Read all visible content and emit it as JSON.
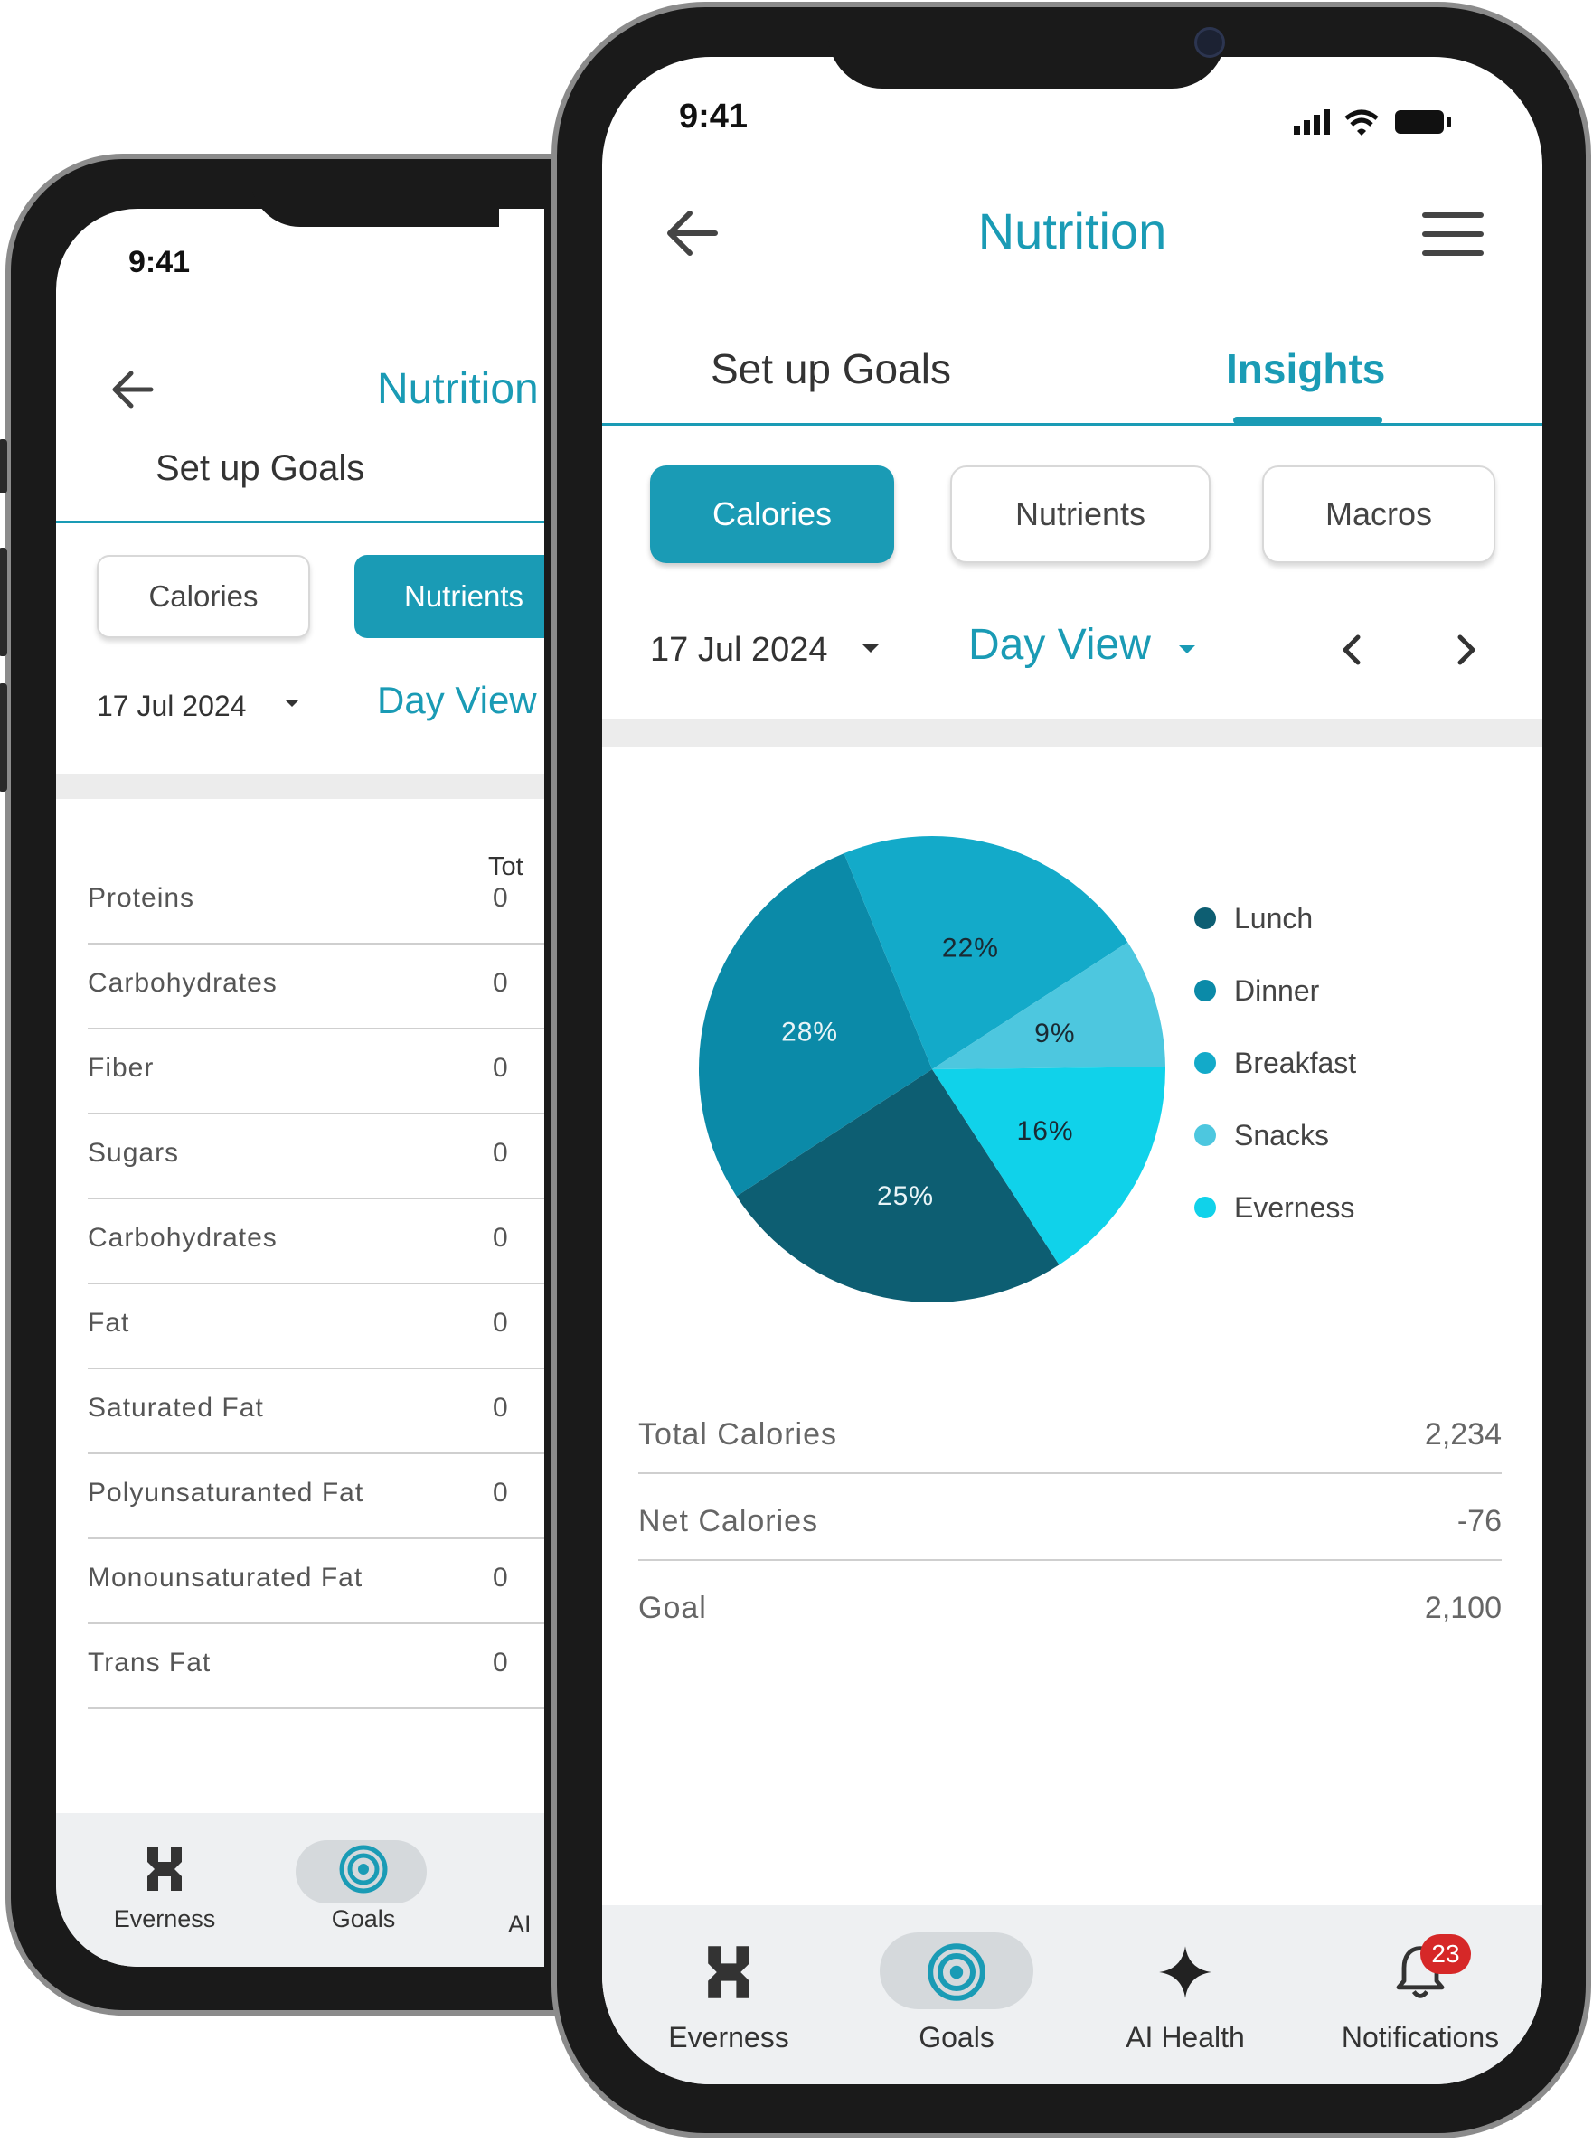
{
  "back_phone": {
    "time": "9:41",
    "title": "Nutrition",
    "tab_setup": "Set up Goals",
    "chip_calories": "Calories",
    "chip_nutrients": "Nutrients",
    "date": "17 Jul 2024",
    "view": "Day View",
    "column_header": "Tot",
    "rows": [
      {
        "label": "Proteins",
        "value": "0"
      },
      {
        "label": "Carbohydrates",
        "value": "0"
      },
      {
        "label": "Fiber",
        "value": "0"
      },
      {
        "label": "Sugars",
        "value": "0"
      },
      {
        "label": "Carbohydrates",
        "value": "0"
      },
      {
        "label": "Fat",
        "value": "0"
      },
      {
        "label": "Saturated Fat",
        "value": "0"
      },
      {
        "label": "Polyunsaturanted Fat",
        "value": "0"
      },
      {
        "label": "Monounsaturated Fat",
        "value": "0"
      },
      {
        "label": "Trans Fat",
        "value": "0"
      }
    ],
    "nav": {
      "everness": "Everness",
      "goals": "Goals",
      "ai": "AI"
    }
  },
  "front_phone": {
    "time": "9:41",
    "title": "Nutrition",
    "tabs": {
      "setup": "Set up Goals",
      "insights": "Insights"
    },
    "chips": {
      "calories": "Calories",
      "nutrients": "Nutrients",
      "macros": "Macros"
    },
    "date": "17 Jul 2024",
    "view": "Day View",
    "summary": [
      {
        "label": "Total Calories",
        "value": "2,234"
      },
      {
        "label": "Net Calories",
        "value": "-76"
      },
      {
        "label": "Goal",
        "value": "2,100"
      }
    ],
    "nav": {
      "everness": "Everness",
      "goals": "Goals",
      "ai_health": "AI Health",
      "notifications": "Notifications",
      "badge": "23"
    }
  },
  "colors": {
    "accent": "#1a9bb5",
    "badge": "#d62828",
    "lunch": "#0d5e72",
    "dinner": "#0b8aa8",
    "breakfast": "#13aac9",
    "snacks": "#4dc7df",
    "everness": "#10d2ea"
  },
  "icons": {
    "back": "arrow-left-icon",
    "menu": "hamburger-menu-icon",
    "caret": "caret-down-icon",
    "prev": "chevron-left-icon",
    "next": "chevron-right-icon",
    "everness": "everness-logo-icon",
    "goals": "target-icon",
    "ai": "sparkle-icon",
    "notifications": "bell-icon"
  },
  "chart_data": {
    "type": "pie",
    "title": "",
    "labels": [
      "Lunch",
      "Dinner",
      "Breakfast",
      "Snacks",
      "Everness"
    ],
    "legend_placement": "right",
    "slices": [
      {
        "label": "Lunch",
        "value": 25,
        "text": "25%",
        "color": "#0d5e72"
      },
      {
        "label": "Dinner",
        "value": 28,
        "text": "28%",
        "color": "#0b8aa8"
      },
      {
        "label": "Breakfast",
        "value": 22,
        "text": "22%",
        "color": "#13aac9"
      },
      {
        "label": "Snacks",
        "value": 9,
        "text": "9%",
        "color": "#4dc7df"
      },
      {
        "label": "Everness",
        "value": 16,
        "text": "16%",
        "color": "#10d2ea"
      }
    ]
  }
}
